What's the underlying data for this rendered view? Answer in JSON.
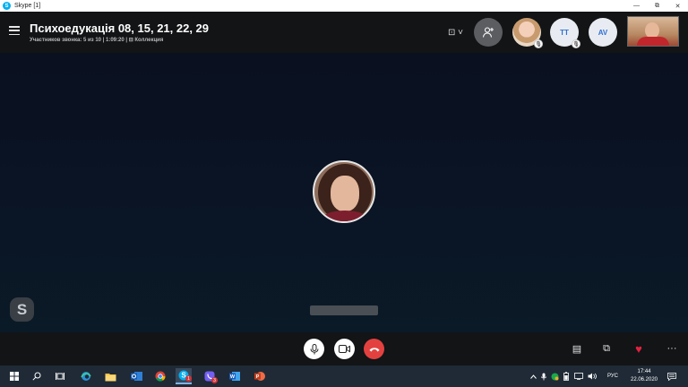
{
  "window": {
    "title": "Skype [1]",
    "app_icon_letter": "S",
    "minimize": "—",
    "restore": "⧉",
    "close": "✕"
  },
  "header": {
    "call_title": "Психоедукація 08, 15, 21, 22, 29",
    "call_info": "Участников звонка: 5 из 10 | 1:09:20 | ⊟ Коллекция",
    "layout_toggle": "⊡ ˅",
    "participants": [
      {
        "initials": "TT"
      },
      {
        "initials": "AV"
      }
    ]
  },
  "stage": {
    "watermark_letter": "S"
  },
  "controls": {
    "chat_icon": "▤",
    "switch_icon": "⧉",
    "react_icon": "♥",
    "more_icon": "···"
  },
  "taskbar": {
    "language": "РУС",
    "time": "17:44",
    "date": "22.06.2020",
    "skype_badge": "1",
    "viber_badge": "3"
  },
  "colors": {
    "accent": "#00aff0",
    "end_call": "#e3413f",
    "react_heart": "#e3213f",
    "stage_bg": "#0a1020",
    "bar_bg": "#121416",
    "taskbar_bg": "#1f2a36"
  }
}
